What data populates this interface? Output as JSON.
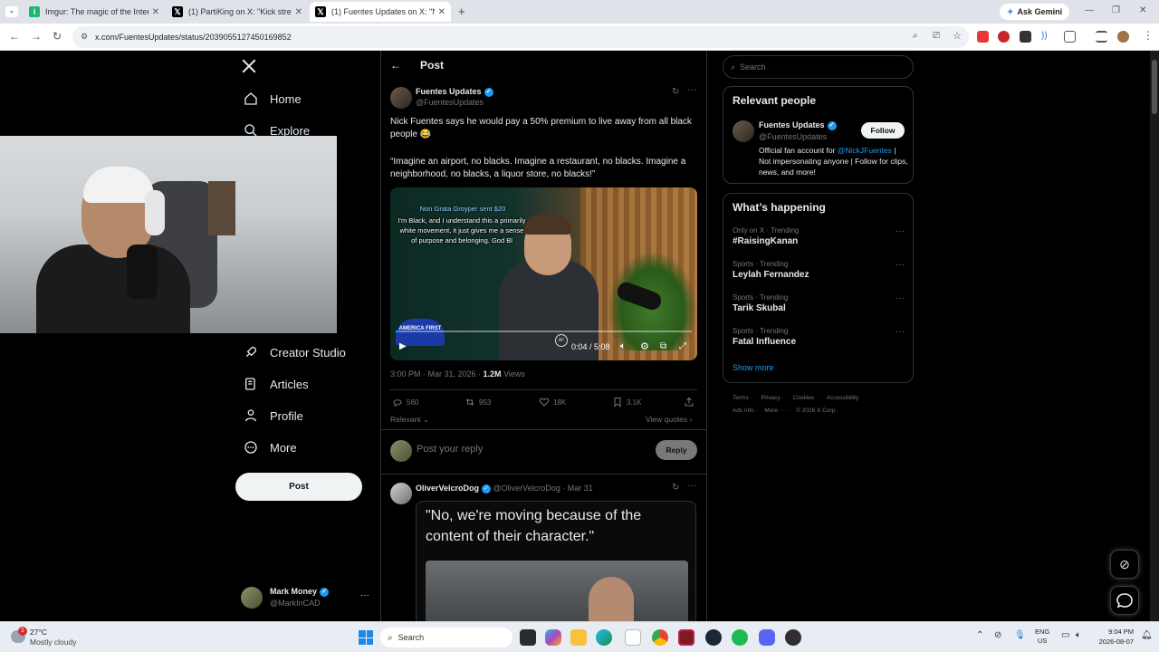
{
  "browser": {
    "tabs": [
      {
        "label": "Imgur: The magic of the Interne",
        "favicon": "imgur-icon"
      },
      {
        "label": "(1) PartiKing on X: \"Kick stream",
        "favicon": "x-icon"
      },
      {
        "label": "(1) Fuentes Updates on X: \"Nick",
        "favicon": "x-icon",
        "active": true
      }
    ],
    "ask_gemini": "Ask Gemini",
    "url": "x.com/FuentesUpdates/status/2039055127450169852"
  },
  "sidebar": {
    "items": [
      {
        "label": "Home",
        "icon": "home-icon"
      },
      {
        "label": "Explore",
        "icon": "search-icon"
      },
      {
        "label": "Creator Studio",
        "icon": "rocket-icon"
      },
      {
        "label": "Articles",
        "icon": "article-icon"
      },
      {
        "label": "Profile",
        "icon": "person-icon"
      },
      {
        "label": "More",
        "icon": "more-circle-icon"
      }
    ],
    "post_button": "Post",
    "account": {
      "name": "Mark Money",
      "handle": "@MarkInCAD"
    }
  },
  "header": {
    "title": "Post"
  },
  "post": {
    "author": "Fuentes Updates",
    "handle": "@FuentesUpdates",
    "text1": "Nick Fuentes says he would pay a 50% premium to live away from all black people 😂",
    "text2": "“Imagine an airport, no blacks. Imagine a restaurant, no blacks. Imagine a neighborhood, no blacks, a liquor store, no blacks!”",
    "video": {
      "donation_title": "Non Grata Groyper sent $20",
      "donation_message": "I'm Black, and I understand this a primarily white movement, it just gives me a sense of purpose and belonging. God Bl",
      "time": "0:04 / 5:08",
      "hat_text": "AMERICA FIRST",
      "watermark": "AF",
      "progress": 0.013
    },
    "timestamp": "3:00 PM · Mar 31, 2026 · ",
    "views_count": "1.2M",
    "views_label": " Views",
    "replies": "560",
    "reposts": "953",
    "likes": "18K",
    "bookmarks": "3.1K",
    "sort_label": "Relevant",
    "view_quotes": "View quotes"
  },
  "reply_box": {
    "placeholder": "Post your reply",
    "button": "Reply"
  },
  "reply": {
    "author": "OliverVelcroDog",
    "handle": "@OliverVelcroDog",
    "date": "· Mar 31",
    "image_caption": "\"No, we're moving because of the content of their character.\""
  },
  "right": {
    "search_placeholder": "Search",
    "relevant_title": "Relevant people",
    "person": {
      "name": "Fuentes Updates",
      "handle": "@FuentesUpdates",
      "bio_prefix": "Official fan account for ",
      "bio_link": "@NickJFuentes",
      "bio_suffix": " | Not impersonating anyone | Follow for clips, news, and more!",
      "follow": "Follow"
    },
    "happening_title": "What’s happening",
    "trends": [
      {
        "meta": "Only on X · Trending",
        "name": "#RaisingKanan"
      },
      {
        "meta": "Sports · Trending",
        "name": "Leylah Fernandez"
      },
      {
        "meta": "Sports · Trending",
        "name": "Tarik Skubal"
      },
      {
        "meta": "Sports · Trending",
        "name": "Fatal Influence"
      }
    ],
    "show_more": "Show more",
    "footer1": [
      "Terms",
      "Privacy",
      "Cookies",
      "Accessibility"
    ],
    "footer2": [
      "Ads info",
      "More ···",
      "© 2026 X Corp."
    ]
  },
  "taskbar": {
    "weather_temp": "27°C",
    "weather_desc": "Mostly cloudy",
    "weather_badge": "1",
    "search_label": "Search",
    "lang1": "ENG",
    "lang2": "US",
    "time": "9:04 PM",
    "date": "2026-08-07"
  }
}
